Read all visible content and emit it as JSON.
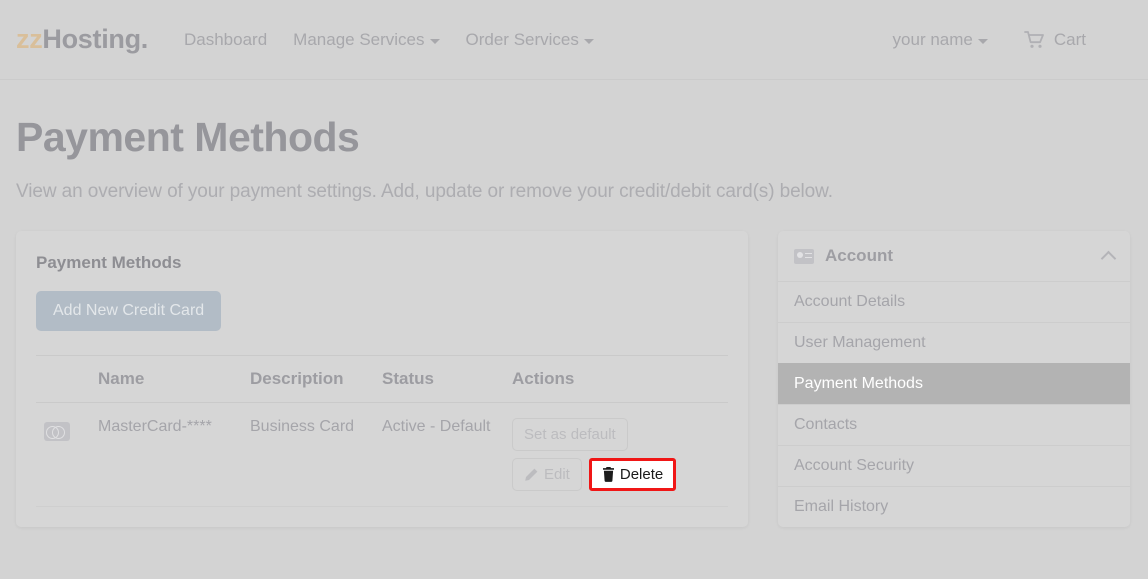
{
  "navbar": {
    "brand_accent": "zz",
    "brand_rest": "Hosting.",
    "accent_color": "#d9bf9a",
    "links": [
      {
        "label": "Dashboard",
        "has_caret": false
      },
      {
        "label": "Manage Services",
        "has_caret": true
      },
      {
        "label": "Order Services",
        "has_caret": true
      }
    ],
    "user_menu": "your name",
    "cart_label": "Cart",
    "cart_icon": "shopping-cart-icon"
  },
  "page": {
    "title": "Payment Methods",
    "subtitle": "View an overview of your payment settings. Add, update or remove your credit/debit card(s) below."
  },
  "main": {
    "heading": "Payment Methods",
    "add_button": "Add New Credit Card",
    "table": {
      "headers": [
        "",
        "Name",
        "Description",
        "Status",
        "Actions"
      ],
      "rows": [
        {
          "icon": "mastercard-icon",
          "name": "MasterCard-****",
          "description": "Business Card",
          "status": "Active - Default",
          "actions": {
            "set_default": "Set as default",
            "edit": "Edit",
            "delete": "Delete"
          }
        }
      ]
    }
  },
  "sidebar": {
    "header": "Account",
    "header_icon": "id-card-icon",
    "collapse_icon": "chevron-up-icon",
    "items": [
      {
        "label": "Account Details",
        "active": false
      },
      {
        "label": "User Management",
        "active": false
      },
      {
        "label": "Payment Methods",
        "active": true
      },
      {
        "label": "Contacts",
        "active": false
      },
      {
        "label": "Account Security",
        "active": false
      },
      {
        "label": "Email History",
        "active": false
      }
    ],
    "active_bg": "#b3b3b3"
  },
  "highlight": {
    "target": "Delete",
    "border_color": "#f01616"
  }
}
